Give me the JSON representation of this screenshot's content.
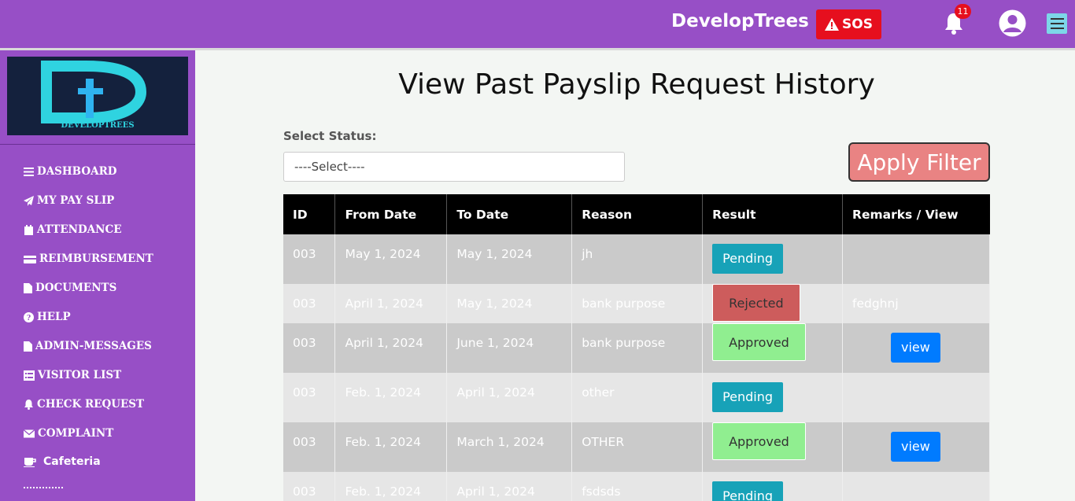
{
  "header": {
    "brand": "DevelopTrees",
    "sos_label": "SOS",
    "notification_count": "11"
  },
  "sidebar": {
    "logo_text": "DEVELOPTREES",
    "items": [
      {
        "label": "DASHBOARD",
        "icon": "list-icon"
      },
      {
        "label": "MY PAY SLIP",
        "icon": "paper-plane-icon"
      },
      {
        "label": "ATTENDANCE",
        "icon": "calendar-icon"
      },
      {
        "label": "REIMBURSEMENT",
        "icon": "credit-card-icon"
      },
      {
        "label": "DOCUMENTS",
        "icon": "file-icon"
      },
      {
        "label": "HELP",
        "icon": "question-icon"
      },
      {
        "label": "ADMIN-MESSAGES",
        "icon": "file-icon"
      },
      {
        "label": "VISITOR LIST",
        "icon": "list-alt-icon"
      },
      {
        "label": "CHECK REQUEST",
        "icon": "bell-icon"
      },
      {
        "label": "COMPLAINT",
        "icon": "envelope-icon"
      },
      {
        "label": "Cafeteria",
        "icon": "coffee-icon"
      }
    ]
  },
  "main": {
    "title": "View Past Payslip Request History",
    "status_label": "Select Status:",
    "select_value": "----Select----",
    "apply_label": "Apply Filter",
    "columns": [
      "ID",
      "From Date",
      "To Date",
      "Reason",
      "Result",
      "Remarks / View"
    ],
    "rows": [
      {
        "id": "003",
        "from": "May 1, 2024",
        "to": "May 1, 2024",
        "reason": "jh",
        "result": "Pending",
        "remarks": "",
        "view": ""
      },
      {
        "id": "003",
        "from": "April 1, 2024",
        "to": "May 1, 2024",
        "reason": "bank purpose",
        "result": "Rejected",
        "remarks": "fedghnj",
        "view": ""
      },
      {
        "id": "003",
        "from": "April 1, 2024",
        "to": "June 1, 2024",
        "reason": "bank purpose",
        "result": "Approved",
        "remarks": "",
        "view": "view"
      },
      {
        "id": "003",
        "from": "Feb. 1, 2024",
        "to": "April 1, 2024",
        "reason": "other",
        "result": "Pending",
        "remarks": "",
        "view": ""
      },
      {
        "id": "003",
        "from": "Feb. 1, 2024",
        "to": "March 1, 2024",
        "reason": "OTHER",
        "result": "Approved",
        "remarks": "",
        "view": "view"
      },
      {
        "id": "003",
        "from": "Feb. 1, 2024",
        "to": "April 1, 2024",
        "reason": "fsdsds",
        "result": "Pending",
        "remarks": "",
        "view": ""
      }
    ]
  }
}
